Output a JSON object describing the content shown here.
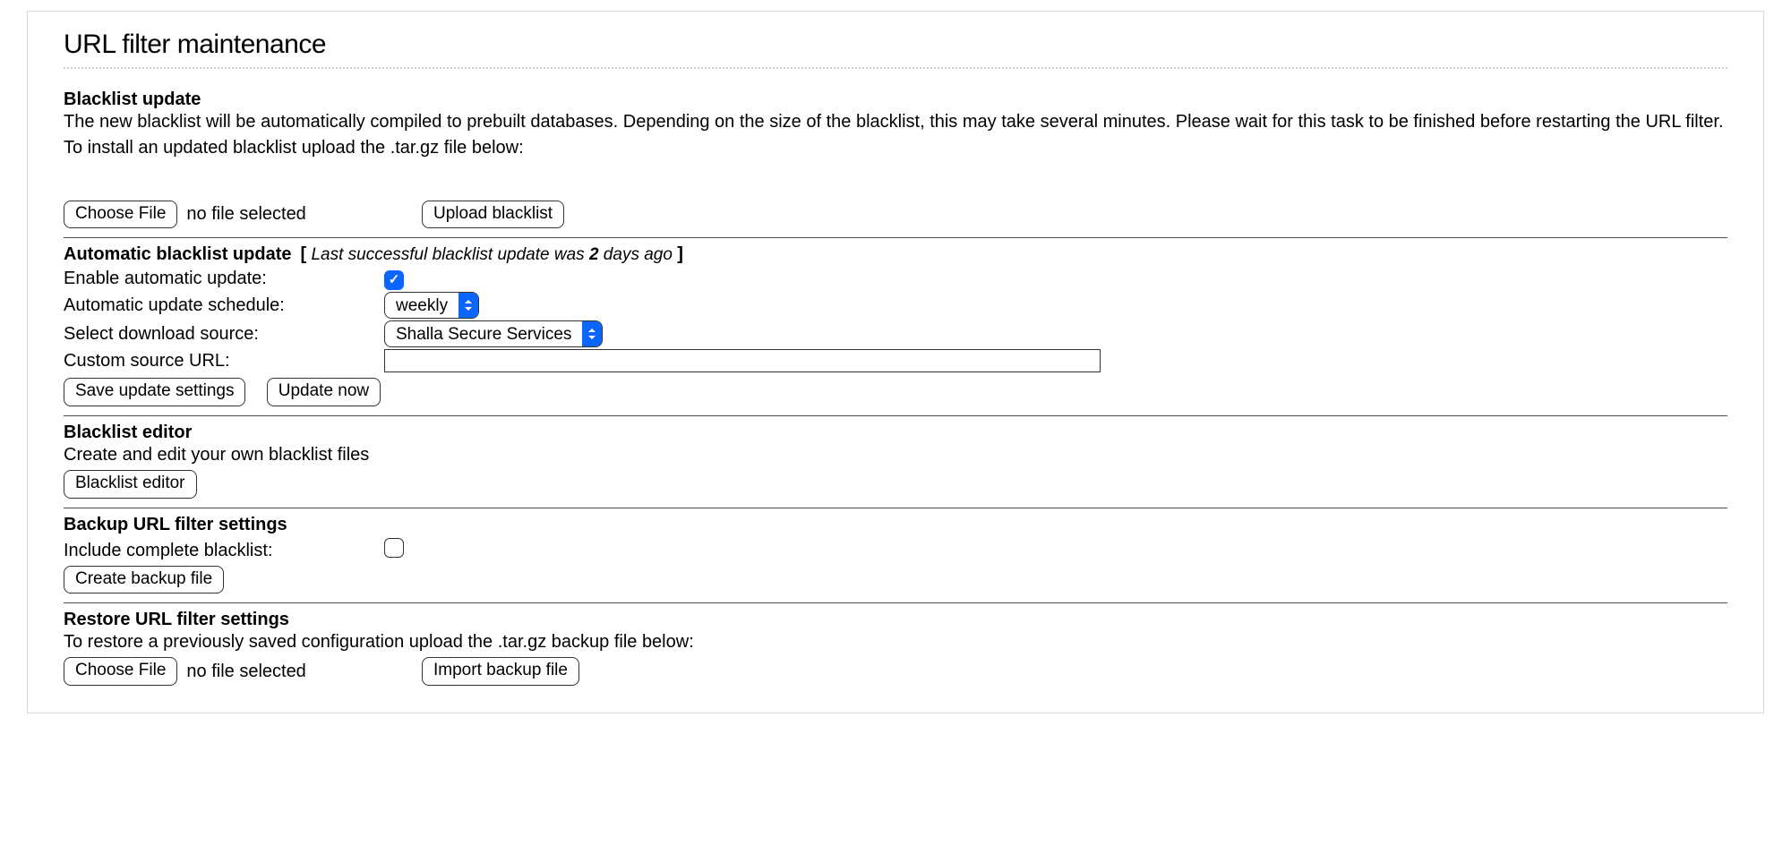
{
  "page": {
    "title": "URL filter maintenance"
  },
  "blacklist_update": {
    "heading": "Blacklist update",
    "desc1": "The new blacklist will be automatically compiled to prebuilt databases. Depending on the size of the blacklist, this may take several minutes. Please wait for this task to be finished before restarting the URL filter.",
    "desc2": "To install an updated blacklist upload the .tar.gz file below:",
    "choose_file_label": "Choose File",
    "file_status": "no file selected",
    "upload_label": "Upload blacklist"
  },
  "auto_update": {
    "heading": "Automatic blacklist update",
    "status_prefix": "Last successful blacklist update was ",
    "status_bold": "2",
    "status_suffix": " days ago",
    "enable_label": "Enable automatic update:",
    "enable_value": true,
    "schedule_label": "Automatic update schedule:",
    "schedule_value": "weekly",
    "source_label": "Select download source:",
    "source_value": "Shalla Secure Services",
    "custom_url_label": "Custom source URL:",
    "custom_url_value": "",
    "save_label": "Save update settings",
    "update_now_label": "Update now"
  },
  "editor": {
    "heading": "Blacklist editor",
    "desc": "Create and edit your own blacklist files",
    "button_label": "Blacklist editor"
  },
  "backup": {
    "heading": "Backup URL filter settings",
    "include_label": "Include complete blacklist:",
    "include_value": false,
    "create_label": "Create backup file"
  },
  "restore": {
    "heading": "Restore URL filter settings",
    "desc": "To restore a previously saved configuration upload the .tar.gz backup file below:",
    "choose_file_label": "Choose File",
    "file_status": "no file selected",
    "import_label": "Import backup file"
  }
}
